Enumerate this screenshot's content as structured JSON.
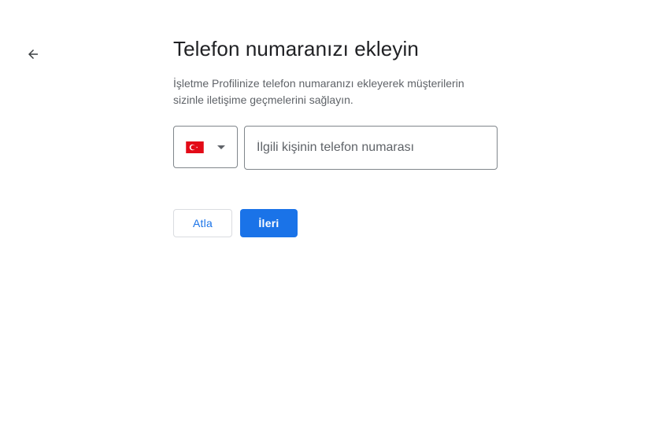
{
  "nav": {
    "back_icon": "arrow-back-icon"
  },
  "header": {
    "title": "Telefon numaranızı ekleyin",
    "subtitle": "İşletme Profilinize telefon numaranızı ekleyerek müşterilerin sizinle iletişime geçmelerini sağlayın."
  },
  "phone": {
    "country_flag_icon": "turkey-flag-icon",
    "country_dropdown_icon": "caret-down-icon",
    "input_value": "",
    "input_placeholder": "İlgili kişinin telefon numarası"
  },
  "actions": {
    "skip_label": "Atla",
    "next_label": "İleri"
  },
  "colors": {
    "primary": "#1a73e8",
    "title_text": "#202124",
    "secondary_text": "#5f6368",
    "border": "#80868b",
    "flag_red": "#e30a17"
  }
}
